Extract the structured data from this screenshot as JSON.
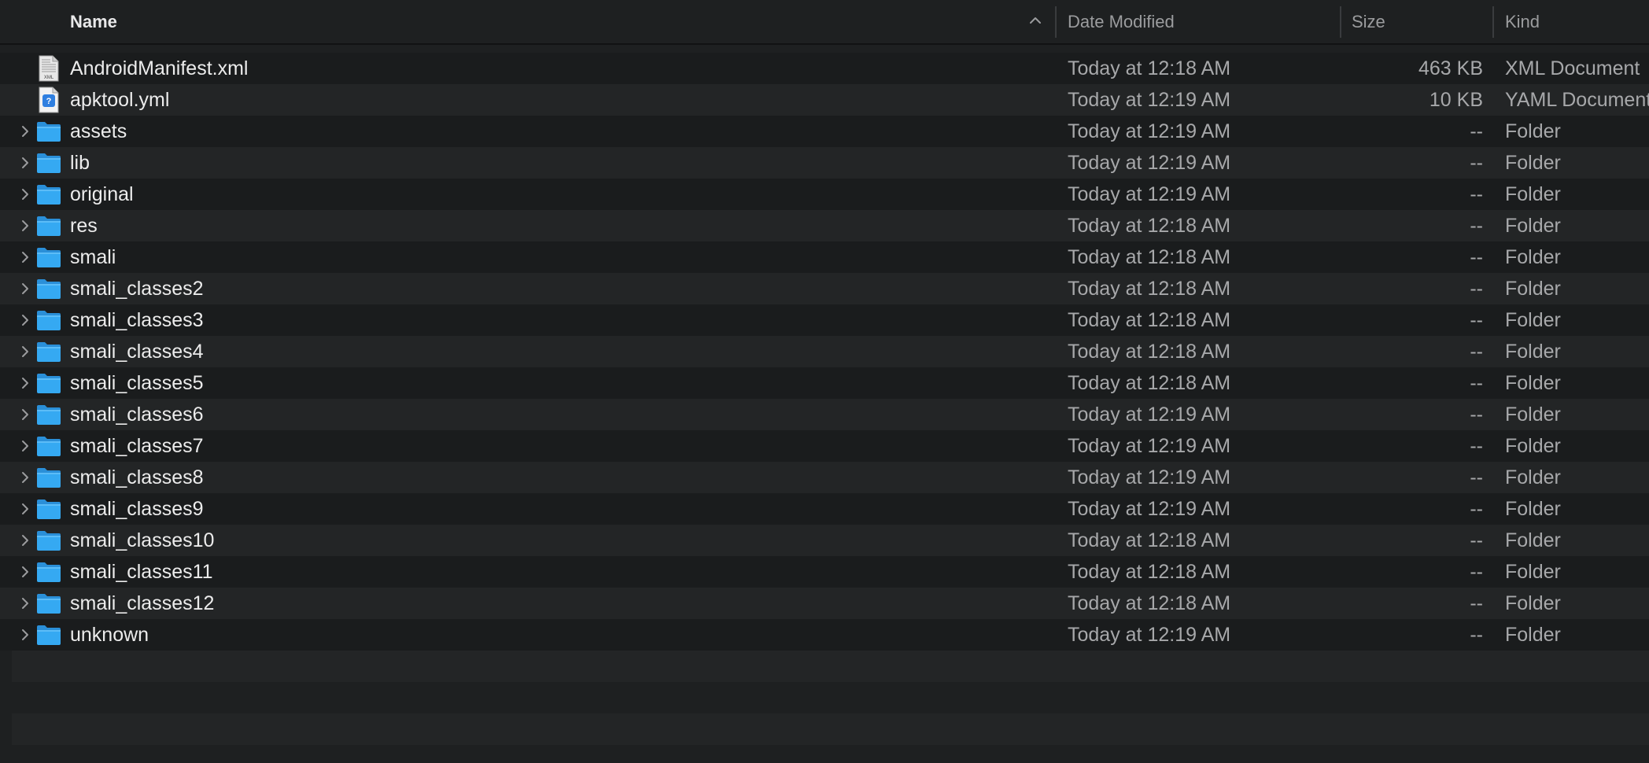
{
  "header": {
    "name_label": "Name",
    "date_label": "Date Modified",
    "size_label": "Size",
    "kind_label": "Kind",
    "sort_direction": "ascending"
  },
  "files": [
    {
      "name": "AndroidManifest.xml",
      "date": "Today at 12:18 AM",
      "size": "463 KB",
      "kind": "XML Document",
      "icon": "xml-document-icon",
      "is_folder": false
    },
    {
      "name": "apktool.yml",
      "date": "Today at 12:19 AM",
      "size": "10 KB",
      "kind": "YAML Document",
      "icon": "yaml-document-icon",
      "is_folder": false
    },
    {
      "name": "assets",
      "date": "Today at 12:19 AM",
      "size": "--",
      "kind": "Folder",
      "icon": "folder-icon",
      "is_folder": true
    },
    {
      "name": "lib",
      "date": "Today at 12:19 AM",
      "size": "--",
      "kind": "Folder",
      "icon": "folder-icon",
      "is_folder": true
    },
    {
      "name": "original",
      "date": "Today at 12:19 AM",
      "size": "--",
      "kind": "Folder",
      "icon": "folder-icon",
      "is_folder": true
    },
    {
      "name": "res",
      "date": "Today at 12:18 AM",
      "size": "--",
      "kind": "Folder",
      "icon": "folder-icon",
      "is_folder": true
    },
    {
      "name": "smali",
      "date": "Today at 12:18 AM",
      "size": "--",
      "kind": "Folder",
      "icon": "folder-icon",
      "is_folder": true
    },
    {
      "name": "smali_classes2",
      "date": "Today at 12:18 AM",
      "size": "--",
      "kind": "Folder",
      "icon": "folder-icon",
      "is_folder": true
    },
    {
      "name": "smali_classes3",
      "date": "Today at 12:18 AM",
      "size": "--",
      "kind": "Folder",
      "icon": "folder-icon",
      "is_folder": true
    },
    {
      "name": "smali_classes4",
      "date": "Today at 12:18 AM",
      "size": "--",
      "kind": "Folder",
      "icon": "folder-icon",
      "is_folder": true
    },
    {
      "name": "smali_classes5",
      "date": "Today at 12:18 AM",
      "size": "--",
      "kind": "Folder",
      "icon": "folder-icon",
      "is_folder": true
    },
    {
      "name": "smali_classes6",
      "date": "Today at 12:19 AM",
      "size": "--",
      "kind": "Folder",
      "icon": "folder-icon",
      "is_folder": true
    },
    {
      "name": "smali_classes7",
      "date": "Today at 12:19 AM",
      "size": "--",
      "kind": "Folder",
      "icon": "folder-icon",
      "is_folder": true
    },
    {
      "name": "smali_classes8",
      "date": "Today at 12:19 AM",
      "size": "--",
      "kind": "Folder",
      "icon": "folder-icon",
      "is_folder": true
    },
    {
      "name": "smali_classes9",
      "date": "Today at 12:19 AM",
      "size": "--",
      "kind": "Folder",
      "icon": "folder-icon",
      "is_folder": true
    },
    {
      "name": "smali_classes10",
      "date": "Today at 12:18 AM",
      "size": "--",
      "kind": "Folder",
      "icon": "folder-icon",
      "is_folder": true
    },
    {
      "name": "smali_classes11",
      "date": "Today at 12:18 AM",
      "size": "--",
      "kind": "Folder",
      "icon": "folder-icon",
      "is_folder": true
    },
    {
      "name": "smali_classes12",
      "date": "Today at 12:18 AM",
      "size": "--",
      "kind": "Folder",
      "icon": "folder-icon",
      "is_folder": true
    },
    {
      "name": "unknown",
      "date": "Today at 12:19 AM",
      "size": "--",
      "kind": "Folder",
      "icon": "folder-icon",
      "is_folder": true
    }
  ],
  "colors": {
    "background": "#1e2021",
    "row_alt": "#232526",
    "folder_blue": "#2fa3ee",
    "text_primary": "#ececec",
    "text_secondary": "#a7a8aa"
  }
}
